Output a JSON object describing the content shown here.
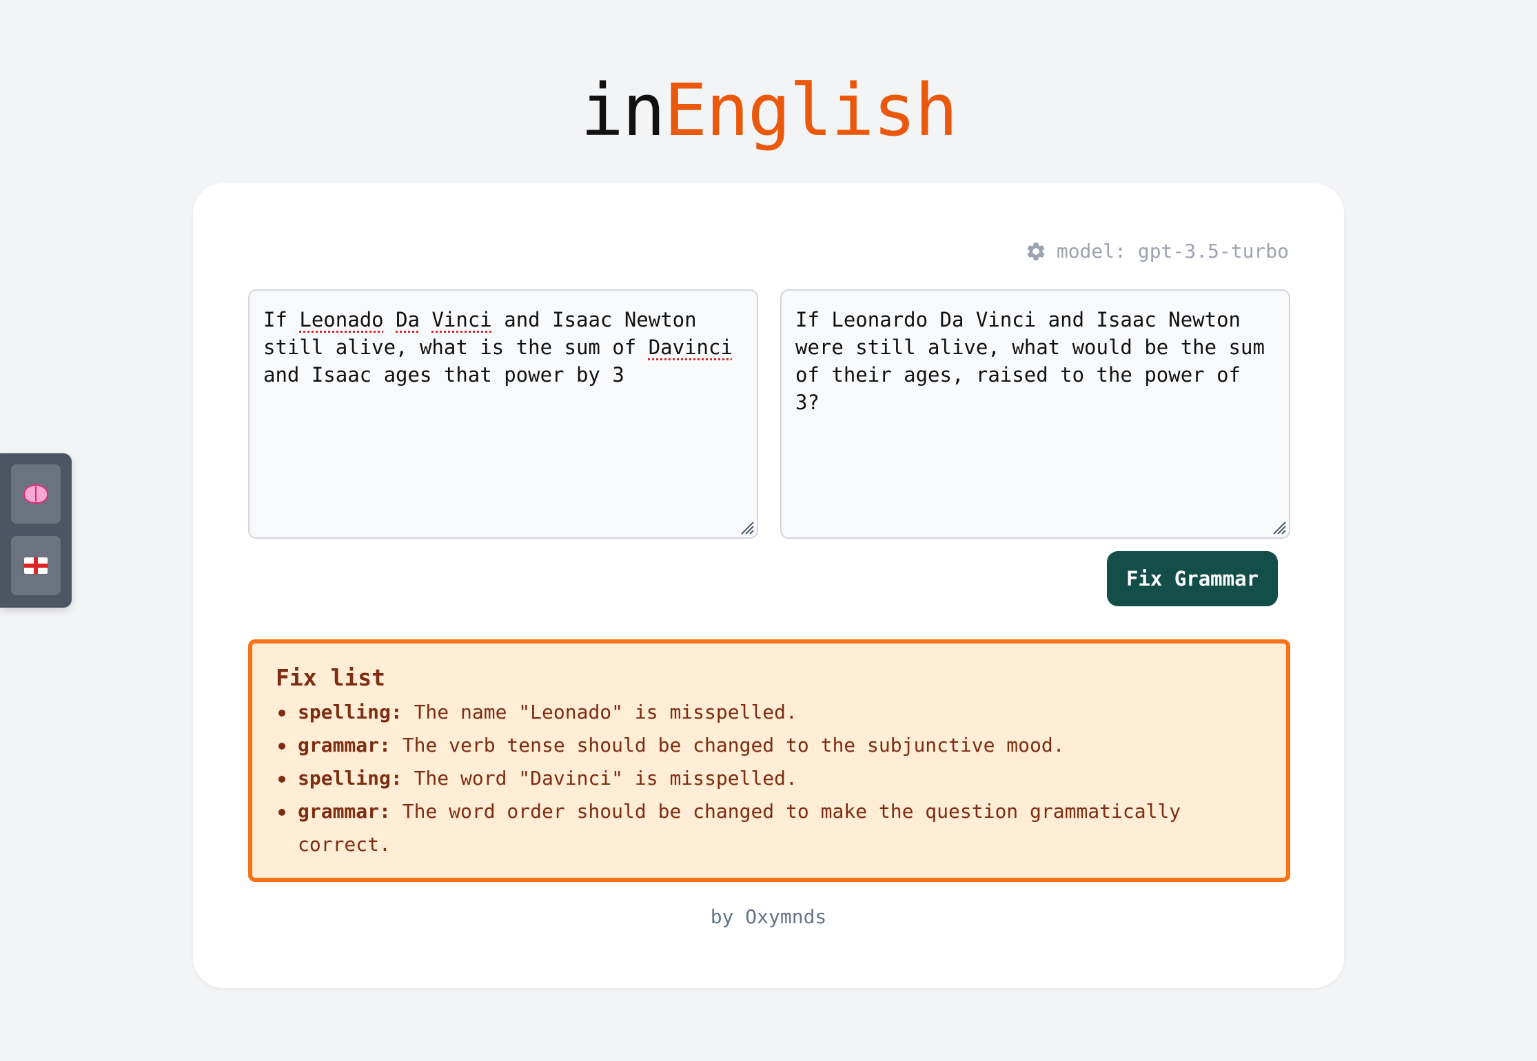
{
  "header": {
    "title_part1": "in",
    "title_part2": "English"
  },
  "side_dock": {
    "buttons": [
      {
        "icon": "brain-icon"
      },
      {
        "icon": "england-flag-icon"
      }
    ]
  },
  "settings": {
    "model_label": "model: gpt-3.5-turbo",
    "icon": "gear-icon"
  },
  "input": {
    "segments": [
      "If ",
      "Leonado",
      " ",
      "Da",
      " ",
      "Vinci",
      " and Isaac Newton\nstill alive, what is the sum of ",
      "Davinci",
      "\nand Isaac ages that power by 3"
    ]
  },
  "output": {
    "text": "If Leonardo Da Vinci and Isaac Newton\nwere still alive, what would be the sum\nof their ages, raised to the power of 3?"
  },
  "actions": {
    "fix_button_label": "Fix Grammar"
  },
  "fix_list": {
    "title": "Fix list",
    "items": [
      {
        "kind": "spelling:",
        "text": " The name \"Leonado\" is misspelled."
      },
      {
        "kind": "grammar:",
        "text": " The verb tense should be changed to the subjunctive mood."
      },
      {
        "kind": "spelling:",
        "text": " The word \"Davinci\" is misspelled."
      },
      {
        "kind": "grammar:",
        "text": " The word order should be changed to make the question grammatically correct."
      }
    ]
  },
  "footer": {
    "credit": "by Oxymnds"
  },
  "colors": {
    "accent": "#ea580c",
    "button": "#134e4a",
    "fix_border": "#f97316",
    "fix_bg": "#ffedd5",
    "fix_text": "#7c2d12"
  }
}
